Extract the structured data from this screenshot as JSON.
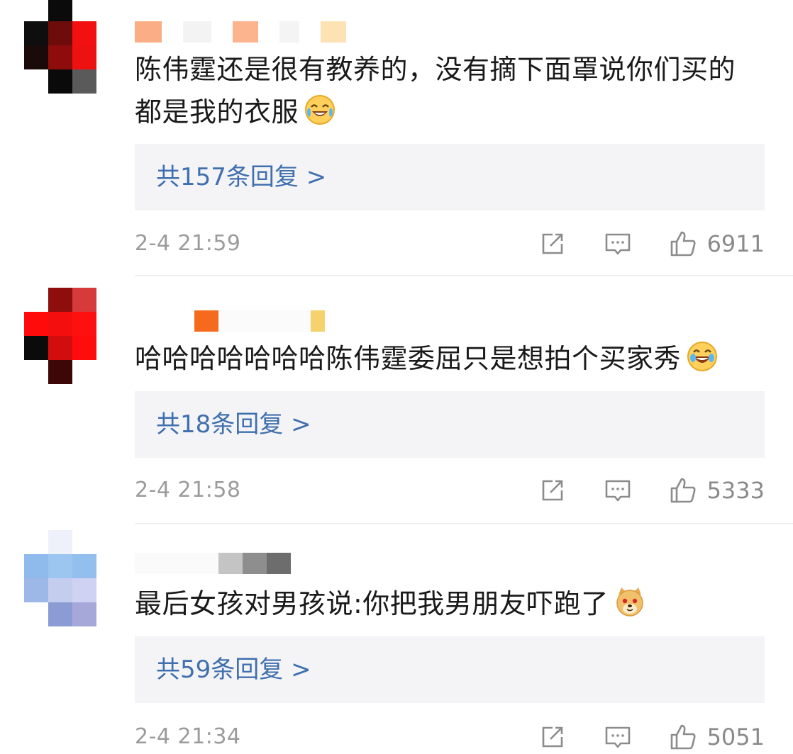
{
  "comments": [
    {
      "text": "陈伟霆还是很有教养的，没有摘下面罩说你们买的都是我的衣服",
      "emoji": "crying-laughing-emoji",
      "replies_label": "共157条回复 >",
      "timestamp": "2-4 21:59",
      "likes": "6911"
    },
    {
      "text": "哈哈哈哈哈哈哈陈伟霆委屈只是想拍个买家秀",
      "emoji": "tears-of-joy-emoji",
      "replies_label": "共18条回复 >",
      "timestamp": "2-4 21:58",
      "likes": "5333"
    },
    {
      "text": "最后女孩对男孩说:你把我男朋友吓跑了",
      "emoji": "doge-emoji",
      "replies_label": "共59条回复 >",
      "timestamp": "2-4 21:34",
      "likes": "5051"
    }
  ],
  "icons": {
    "share": "share-icon",
    "reply": "comment-icon",
    "like": "thumbs-up-icon"
  },
  "colors": {
    "link": "#3f6fae",
    "meta": "#9b9b9b",
    "reply_bg": "#f4f4f6"
  }
}
